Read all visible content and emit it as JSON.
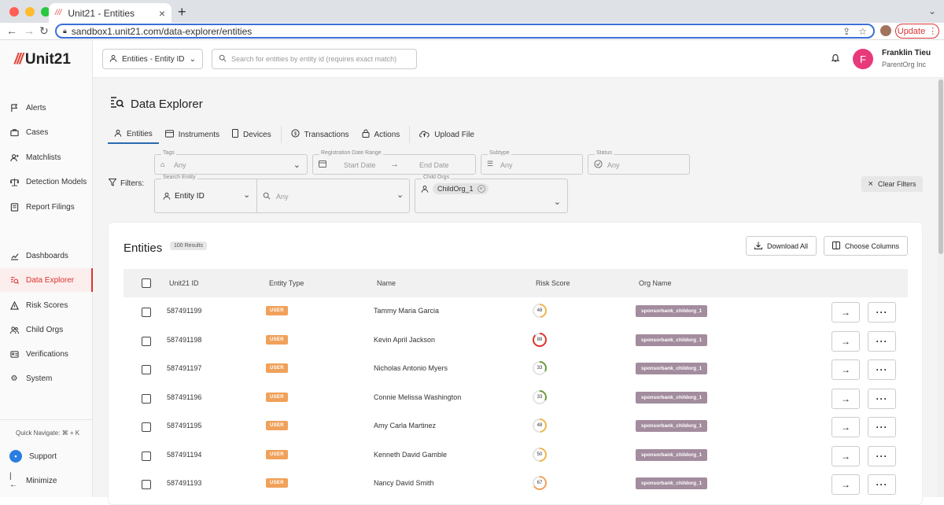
{
  "browser": {
    "tab_title": "Unit21 - Entities",
    "url": "sandbox1.unit21.com/data-explorer/entities",
    "update_label": "Update",
    "traffic_colors": [
      "#ff5f57",
      "#febc2e",
      "#28c840"
    ]
  },
  "sidebar": {
    "logo_text": "Unit21",
    "logo_mark": "///",
    "items": [
      {
        "label": "Alerts",
        "icon": "flag-icon"
      },
      {
        "label": "Cases",
        "icon": "briefcase-icon"
      },
      {
        "label": "Matchlists",
        "icon": "person-plus-icon"
      },
      {
        "label": "Detection Models",
        "icon": "scale-icon"
      },
      {
        "label": "Report Filings",
        "icon": "report-icon"
      },
      {
        "label": "Dashboards",
        "icon": "chart-icon"
      },
      {
        "label": "Data Explorer",
        "icon": "data-explorer-icon"
      },
      {
        "label": "Risk Scores",
        "icon": "warning-icon"
      },
      {
        "label": "Child Orgs",
        "icon": "people-icon"
      },
      {
        "label": "Verifications",
        "icon": "id-card-icon"
      },
      {
        "label": "System",
        "icon": "gear-icon"
      }
    ],
    "quick_navigate": "Quick Navigate: ⌘ + K",
    "support_label": "Support",
    "minimize_label": "Minimize"
  },
  "topbar": {
    "entity_select": "Entities - Entity ID",
    "search_placeholder": "Search for entities by entity id (requires exact match)",
    "user_initial": "F",
    "user_name": "Franklin Tieu",
    "user_org": "ParentOrg Inc",
    "avatar_color": "#e83a7a"
  },
  "page": {
    "title": "Data Explorer",
    "tabs": [
      "Entities",
      "Instruments",
      "Devices",
      "Transactions",
      "Actions",
      "Upload File"
    ]
  },
  "filters": {
    "label": "Filters:",
    "tags_label": "Tags",
    "tags_value": "Any",
    "date_label": "Registration Date Range",
    "start_date": "Start Date",
    "end_date": "End Date",
    "subtype_label": "Subtype",
    "subtype_value": "Any",
    "status_label": "Status",
    "status_value": "Any",
    "search_entity_label": "Search Entity",
    "search_entity_value": "Entity ID",
    "search_any": "Any",
    "child_orgs_label": "Child Orgs",
    "child_org_chip": "ChildOrg_1",
    "clear_label": "Clear Filters"
  },
  "table": {
    "title": "Entities",
    "results_badge": "100 Results",
    "download_label": "Download All",
    "columns_label": "Choose Columns",
    "headers": {
      "id": "Unit21 ID",
      "type": "Entity Type",
      "name": "Name",
      "risk": "Risk Score",
      "org": "Org Name"
    },
    "rows": [
      {
        "id": "587491199",
        "type": "USER",
        "name": "Tammy Maria Garcia",
        "risk": 48,
        "org": "sponsorbank_childorg_1"
      },
      {
        "id": "587491198",
        "type": "USER",
        "name": "Kevin April Jackson",
        "risk": 88,
        "org": "sponsorbank_childorg_1"
      },
      {
        "id": "587491197",
        "type": "USER",
        "name": "Nicholas Antonio Myers",
        "risk": 33,
        "org": "sponsorbank_childorg_1"
      },
      {
        "id": "587491196",
        "type": "USER",
        "name": "Connie Melissa Washington",
        "risk": 33,
        "org": "sponsorbank_childorg_1"
      },
      {
        "id": "587491195",
        "type": "USER",
        "name": "Amy Carla Martinez",
        "risk": 48,
        "org": "sponsorbank_childorg_1"
      },
      {
        "id": "587491194",
        "type": "USER",
        "name": "Kenneth David Gamble",
        "risk": 50,
        "org": "sponsorbank_childorg_1"
      },
      {
        "id": "587491193",
        "type": "USER",
        "name": "Nancy David Smith",
        "risk": 67,
        "org": "sponsorbank_childorg_1"
      }
    ]
  }
}
